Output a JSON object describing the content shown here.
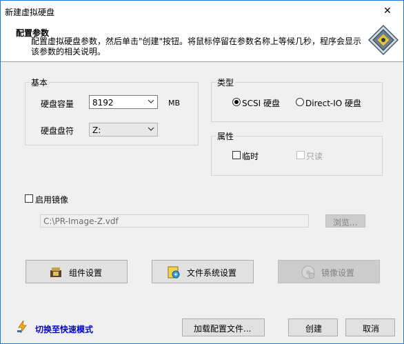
{
  "window": {
    "title": "新建虚拟硬盘",
    "close_glyph": "✕"
  },
  "header": {
    "title": "配置参数",
    "description": "配置虚拟硬盘参数，然后单击\"创建\"按钮。将鼠标停留在参数名称上等候几秒，程序会显示该参数的相关说明。",
    "icon": "hard-disk-icon"
  },
  "basic": {
    "legend": "基本",
    "capacity_label": "硬盘容量",
    "capacity_value": "8192",
    "capacity_unit": "MB",
    "drive_label": "硬盘盘符",
    "drive_value": "Z:"
  },
  "type": {
    "legend": "类型",
    "scsi_label": "SCSI 硬盘",
    "directio_label": "Direct-IO 硬盘",
    "selected": "scsi"
  },
  "attributes": {
    "legend": "属性",
    "temporary_label": "临时",
    "readonly_label": "只读"
  },
  "image": {
    "enable_label": "启用镜像",
    "path_value": "C:\\PR-Image-Z.vdf",
    "browse_label": "浏览..."
  },
  "actions": {
    "component_settings": "组件设置",
    "filesystem_settings": "文件系统设置",
    "image_settings": "镜像设置"
  },
  "footer": {
    "fast_mode": "切换至快速模式",
    "load_config": "加载配置文件...",
    "create": "创建",
    "cancel": "取消"
  }
}
